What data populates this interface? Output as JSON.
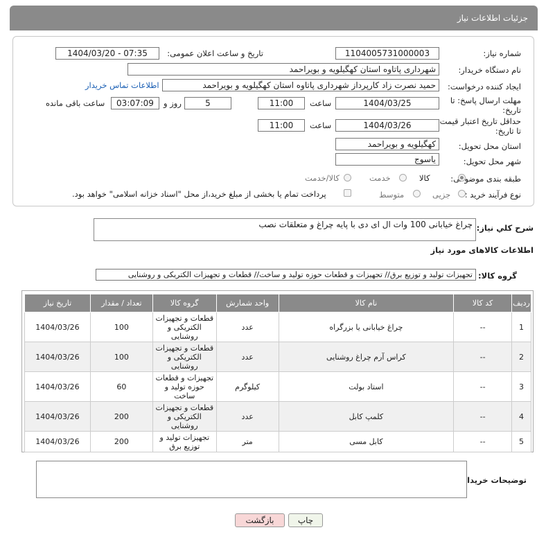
{
  "header": {
    "title": "جزئیات اطلاعات نیاز"
  },
  "labels": {
    "need_number": "شماره نیاز:",
    "announce": "تاریخ و ساعت اعلان عمومی:",
    "buyer_org": "نام دستگاه خریدار:",
    "creator": "ایجاد کننده درخواست:",
    "buyer_contact": "اطلاعات تماس خریدار",
    "reply_deadline": "مهلت ارسال پاسخ: تا تاریخ:",
    "time": "ساعت",
    "day_and": "روز و",
    "remaining": "ساعت باقی مانده",
    "price_validity": "حداقل تاریخ اعتبار قیمت: تا تاریخ:",
    "province": "استان محل تحویل:",
    "city": "شهر محل تحویل:",
    "category": "طبقه بندی موضوعی:",
    "process": "نوع فرآیند خرید :",
    "description": "شرح کلي نياز:",
    "goods_info": "اطلاعات کالاهای مورد نیاز",
    "goods_group": "گروه کالا:",
    "buyer_notes": "توضیحات خریدار:"
  },
  "fields": {
    "need_number": "1104005731000003",
    "announce_datetime": "1404/03/20 - 07:35",
    "buyer_org": "شهرداری پاتاوه استان کهگیلویه و بویراحمد",
    "creator": "حمید نصرت زاد کارپرداز شهرداری پاتاوه استان کهگیلویه و بویراحمد",
    "reply_date": "1404/03/25",
    "reply_time": "11:00",
    "days": "5",
    "remaining_time": "03:07:09",
    "validity_date": "1404/03/26",
    "validity_time": "11:00",
    "province": "کهگیلویه و بویراحمد",
    "city": "یاسوج",
    "description": "چراغ خیابانی 100 وات ال ای دی با پایه چراغ و متعلقات نصب",
    "goods_group": "تجهیزات تولید و توزیع برق// تجهیزات و قطعات حوزه تولید و ساخت// قطعات و تجهیزات الکتریکی و روشنایی",
    "buyer_notes": ""
  },
  "category_options": [
    "کالا",
    "خدمت",
    "کالا/خدمت"
  ],
  "category_selected": "کالا",
  "process_options": [
    "جزیی",
    "متوسط"
  ],
  "process_note": "پرداخت تمام یا بخشی از مبلغ خرید،از محل \"اسناد خزانه اسلامی\" خواهد بود.",
  "table": {
    "headers": [
      "ردیف",
      "کد کالا",
      "نام کالا",
      "واحد شمارش",
      "گروه کالا",
      "تعداد / مقدار",
      "تاریخ نیاز"
    ],
    "rows": [
      [
        "1",
        "--",
        "چراغ خیابانی یا بزرگراه",
        "عدد",
        "قطعات و تجهیزات الکتریکی و روشنایی",
        "100",
        "1404/03/26"
      ],
      [
        "2",
        "--",
        "کراس آرم چراغ روشنایی",
        "عدد",
        "قطعات و تجهیزات الکتریکی و روشنایی",
        "100",
        "1404/03/26"
      ],
      [
        "3",
        "--",
        "استاد بولت",
        "کیلوگرم",
        "تجهیزات و قطعات حوزه تولید و ساخت",
        "60",
        "1404/03/26"
      ],
      [
        "4",
        "--",
        "کلمپ کابل",
        "عدد",
        "قطعات و تجهیزات الکتریکی و روشنایی",
        "200",
        "1404/03/26"
      ],
      [
        "5",
        "--",
        "کابل مسی",
        "متر",
        "تجهیزات تولید و توزیع برق",
        "200",
        "1404/03/26"
      ]
    ]
  },
  "buttons": {
    "print": "چاپ",
    "back": "بازگشت"
  }
}
